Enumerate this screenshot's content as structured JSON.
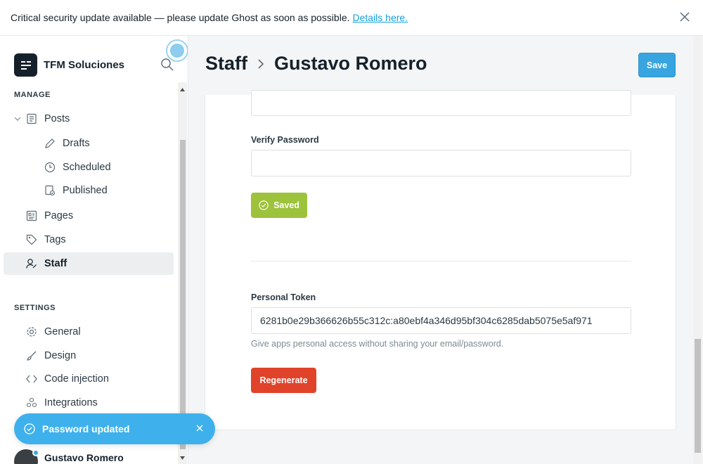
{
  "banner": {
    "message": "Critical security update available — please update Ghost as soon as possible.",
    "link_text": "Details here."
  },
  "sidebar": {
    "site_name": "TFM Soluciones",
    "manage_label": "MANAGE",
    "posts_label": "Posts",
    "drafts_label": "Drafts",
    "scheduled_label": "Scheduled",
    "published_label": "Published",
    "pages_label": "Pages",
    "tags_label": "Tags",
    "staff_label": "Staff",
    "settings_label": "SETTINGS",
    "general_label": "General",
    "design_label": "Design",
    "code_injection_label": "Code injection",
    "integrations_label": "Integrations",
    "user_name": "Gustavo Romero"
  },
  "toast": {
    "message": "Password updated"
  },
  "header": {
    "crumb_parent": "Staff",
    "crumb_current": "Gustavo Romero",
    "save_label": "Save"
  },
  "form": {
    "verify_password_label": "Verify Password",
    "saved_label": "Saved",
    "token_label": "Personal Token",
    "token_value": "6281b0e29b366626b55c312c:a80ebf4a346d95bf304c6285dab5075e5af971",
    "token_hint": "Give apps personal access without sharing your email/password.",
    "regenerate_label": "Regenerate"
  },
  "colors": {
    "accent": "#38a5e0",
    "success": "#9dc23b",
    "danger": "#e0432a"
  }
}
